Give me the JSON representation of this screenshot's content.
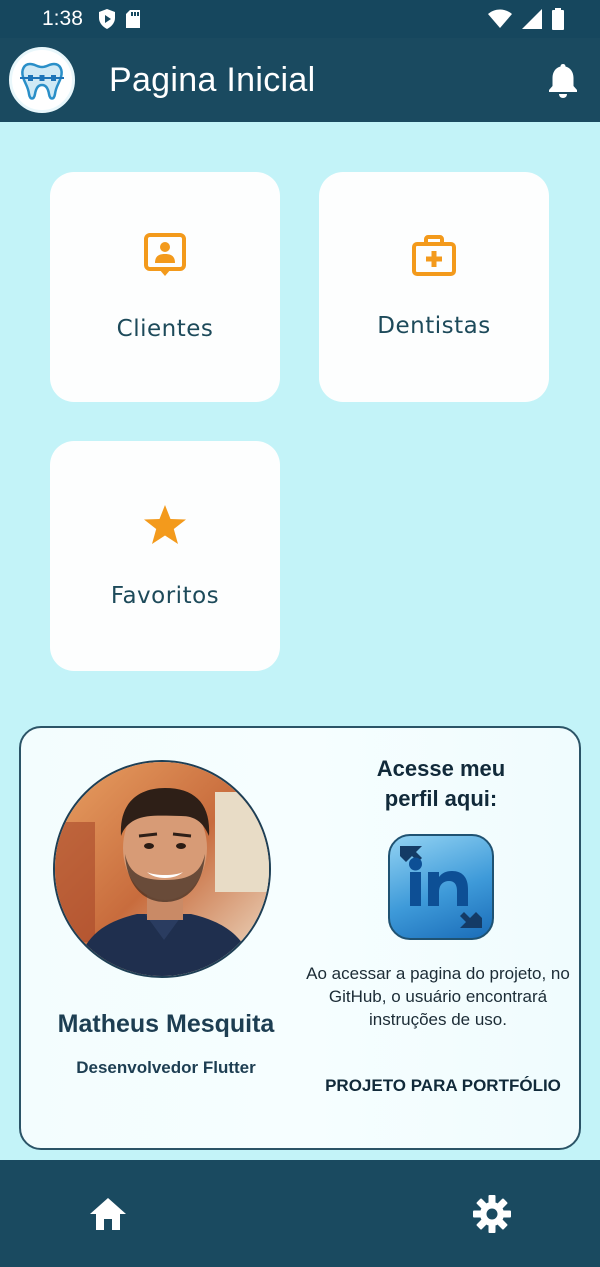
{
  "status_bar": {
    "time": "1:38",
    "icons": [
      "shield-icon",
      "sd-card-icon",
      "wifi-icon",
      "signal-icon",
      "battery-icon"
    ]
  },
  "app_bar": {
    "title": "Pagina Inicial",
    "logo_icon": "tooth-logo-icon",
    "action_icon": "bell-icon"
  },
  "menu": {
    "cards": [
      {
        "label": "Clientes",
        "icon": "contact-badge-icon"
      },
      {
        "label": "Dentistas",
        "icon": "medical-case-icon"
      },
      {
        "label": "Favoritos",
        "icon": "star-icon"
      }
    ]
  },
  "profile": {
    "name": "Matheus Mesquita",
    "role": "Desenvolvedor Flutter",
    "access_title_line1": "Acesse meu",
    "access_title_line2": "perfil aqui:",
    "linkedin_icon": "linkedin-icon",
    "info": "Ao acessar a pagina do projeto, no GitHub, o usuário encontrará instruções de uso.",
    "portfolio": "PROJETO PARA PORTFÓLIO"
  },
  "bottom_nav": {
    "items": [
      {
        "icon": "home-icon"
      },
      {
        "icon": "settings-icon"
      }
    ]
  },
  "colors": {
    "app_bar": "#1a4a60",
    "background": "#c3f3f8",
    "card": "#fdfefe",
    "accent_icon": "#f39a1c",
    "card_text": "#1d4a5a"
  }
}
